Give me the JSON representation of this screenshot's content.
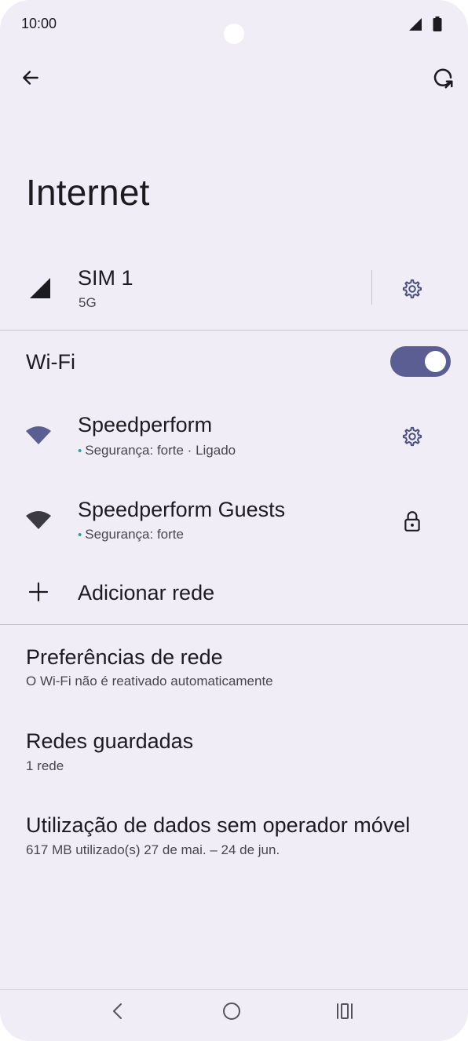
{
  "status_bar": {
    "time": "10:00"
  },
  "header": {
    "title": "Internet"
  },
  "sim": {
    "title": "SIM 1",
    "subtitle": "5G"
  },
  "wifi": {
    "label": "Wi-Fi",
    "enabled": true
  },
  "networks": [
    {
      "name": "Speedperform",
      "status": "Segurança: forte · Ligado",
      "icon_color": "#5b5e92",
      "action_icon": "gear-icon"
    },
    {
      "name": "Speedperform Guests",
      "status": "Segurança: forte",
      "icon_color": "#3a3a40",
      "action_icon": "lock-icon"
    }
  ],
  "add_network": {
    "label": "Adicionar rede"
  },
  "menu": [
    {
      "title": "Preferências de rede",
      "subtitle": "O Wi-Fi não é reativado automaticamente"
    },
    {
      "title": "Redes guardadas",
      "subtitle": "1 rede"
    },
    {
      "title": "Utilização de dados sem operador móvel",
      "subtitle": "617 MB utilizado(s) 27 de mai. – 24 de jun."
    }
  ],
  "colors": {
    "accent": "#5b5e92",
    "status_dot": "#2aa39a",
    "background": "#f1edf6"
  }
}
